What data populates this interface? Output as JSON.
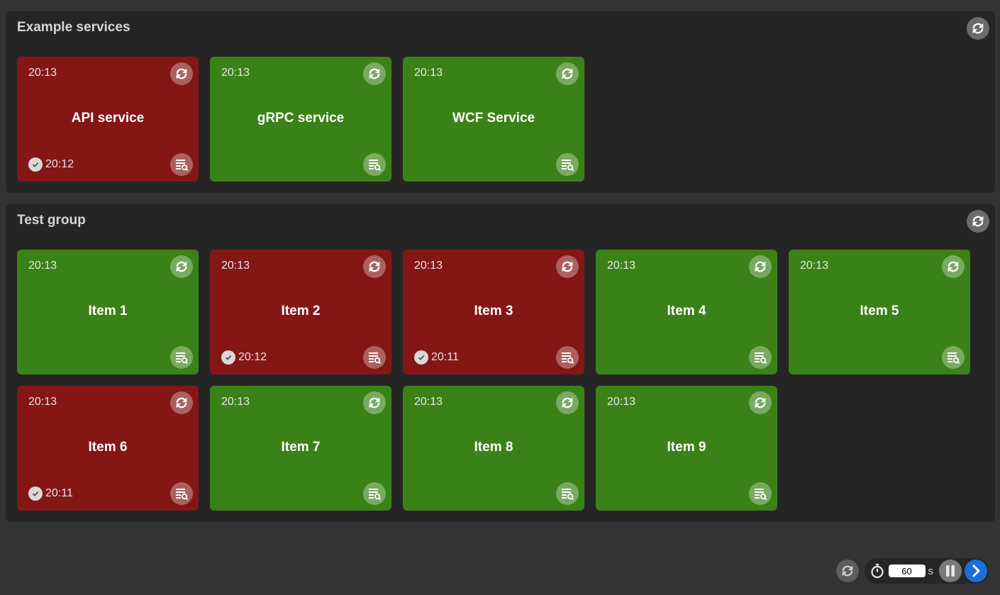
{
  "colors": {
    "ok": "#3a8217",
    "error": "#851616",
    "accent": "#1a6fd6"
  },
  "groups": [
    {
      "title": "Example services",
      "refresh_icon": "refresh-icon",
      "tiles": [
        {
          "name": "API service",
          "time": "20:13",
          "status": "error",
          "ack_time": "20:12"
        },
        {
          "name": "gRPC service",
          "time": "20:13",
          "status": "ok"
        },
        {
          "name": "WCF Service",
          "time": "20:13",
          "status": "ok"
        }
      ]
    },
    {
      "title": "Test group",
      "refresh_icon": "refresh-icon",
      "tiles": [
        {
          "name": "Item 1",
          "time": "20:13",
          "status": "ok"
        },
        {
          "name": "Item 2",
          "time": "20:13",
          "status": "error",
          "ack_time": "20:12"
        },
        {
          "name": "Item 3",
          "time": "20:13",
          "status": "error",
          "ack_time": "20:11"
        },
        {
          "name": "Item 4",
          "time": "20:13",
          "status": "ok"
        },
        {
          "name": "Item 5",
          "time": "20:13",
          "status": "ok"
        },
        {
          "name": "Item 6",
          "time": "20:13",
          "status": "error",
          "ack_time": "20:11"
        },
        {
          "name": "Item 7",
          "time": "20:13",
          "status": "ok"
        },
        {
          "name": "Item 8",
          "time": "20:13",
          "status": "ok"
        },
        {
          "name": "Item 9",
          "time": "20:13",
          "status": "ok"
        }
      ]
    }
  ],
  "footer": {
    "interval_value": "60",
    "interval_unit": "s",
    "icons": [
      "refresh-icon",
      "stopwatch-icon",
      "pause-icon",
      "chevron-right-icon"
    ]
  }
}
